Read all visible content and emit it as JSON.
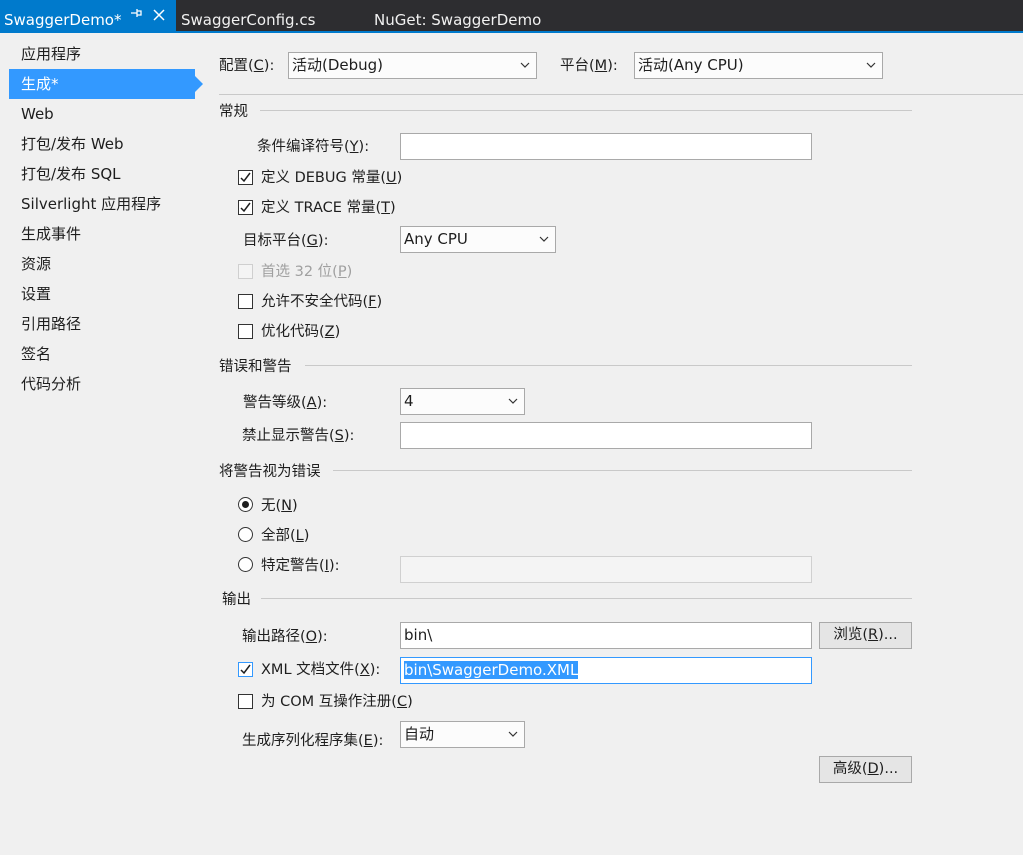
{
  "tabs": {
    "active": "SwaggerDemo*",
    "pin_glyph": "⊣",
    "close_glyph": "✕",
    "second": "SwaggerConfig.cs",
    "third": "NuGet: SwaggerDemo"
  },
  "sidebar": {
    "items": [
      "应用程序",
      "生成*",
      "Web",
      "打包/发布 Web",
      "打包/发布 SQL",
      "Silverlight 应用程序",
      "生成事件",
      "资源",
      "设置",
      "引用路径",
      "签名",
      "代码分析"
    ],
    "active_index": 1
  },
  "config": {
    "configuration_label": "配置(",
    "configuration_key": "C",
    "configuration_suffix": "):",
    "configuration_value": "活动(Debug)",
    "platform_label": "平台(",
    "platform_key": "M",
    "platform_suffix": "):",
    "platform_value": "活动(Any CPU)"
  },
  "general": {
    "header": "常规",
    "conditional_symbols_label": "条件编译符号(",
    "conditional_symbols_key": "Y",
    "conditional_symbols_suffix": "):",
    "conditional_symbols_value": "",
    "define_debug_label": "定义 DEBUG 常量(",
    "define_debug_key": "U",
    "define_debug_checked": true,
    "define_trace_label": "定义 TRACE 常量(",
    "define_trace_key": "T",
    "define_trace_checked": true,
    "platform_target_label": "目标平台(",
    "platform_target_key": "G",
    "platform_target_suffix": "):",
    "platform_target_value": "Any CPU",
    "prefer32_label": "首选 32 位(",
    "prefer32_key": "P",
    "prefer32_checked": false,
    "unsafe_label": "允许不安全代码(",
    "unsafe_key": "F",
    "unsafe_checked": false,
    "optimize_label": "优化代码(",
    "optimize_key": "Z",
    "optimize_checked": false
  },
  "errors": {
    "header": "错误和警告",
    "warning_level_label": "警告等级(",
    "warning_level_key": "A",
    "warning_level_suffix": "):",
    "warning_level_value": "4",
    "suppress_label": "禁止显示警告(",
    "suppress_key": "S",
    "suppress_suffix": "):",
    "suppress_value": ""
  },
  "treat_warnings": {
    "header": "将警告视为错误",
    "none_label": "无(",
    "none_key": "N",
    "all_label": "全部(",
    "all_key": "L",
    "specific_label": "特定警告(",
    "specific_key": "I",
    "specific_suffix": "):",
    "specific_value": "",
    "selected": "none"
  },
  "output": {
    "header": "输出",
    "output_path_label": "输出路径(",
    "output_path_key": "O",
    "output_path_suffix": "):",
    "output_path_value": "bin\\",
    "browse_label": "浏览(",
    "browse_key": "R",
    "browse_suffix": ")...",
    "xml_doc_label": "XML 文档文件(",
    "xml_doc_key": "X",
    "xml_doc_suffix": "):",
    "xml_doc_checked": true,
    "xml_doc_value": "bin\\SwaggerDemo.XML",
    "com_interop_label": "为 COM 互操作注册(",
    "com_interop_key": "C",
    "com_interop_checked": false,
    "serialization_label": "生成序列化程序集(",
    "serialization_key": "E",
    "serialization_suffix": "):",
    "serialization_value": "自动",
    "advanced_label": "高级(",
    "advanced_key": "D",
    "advanced_suffix": ")..."
  },
  "colors": {
    "accent": "#007acc",
    "selection": "#3399ff",
    "tab_bg": "#2d2d30",
    "page_bg": "#f0f0f0"
  }
}
